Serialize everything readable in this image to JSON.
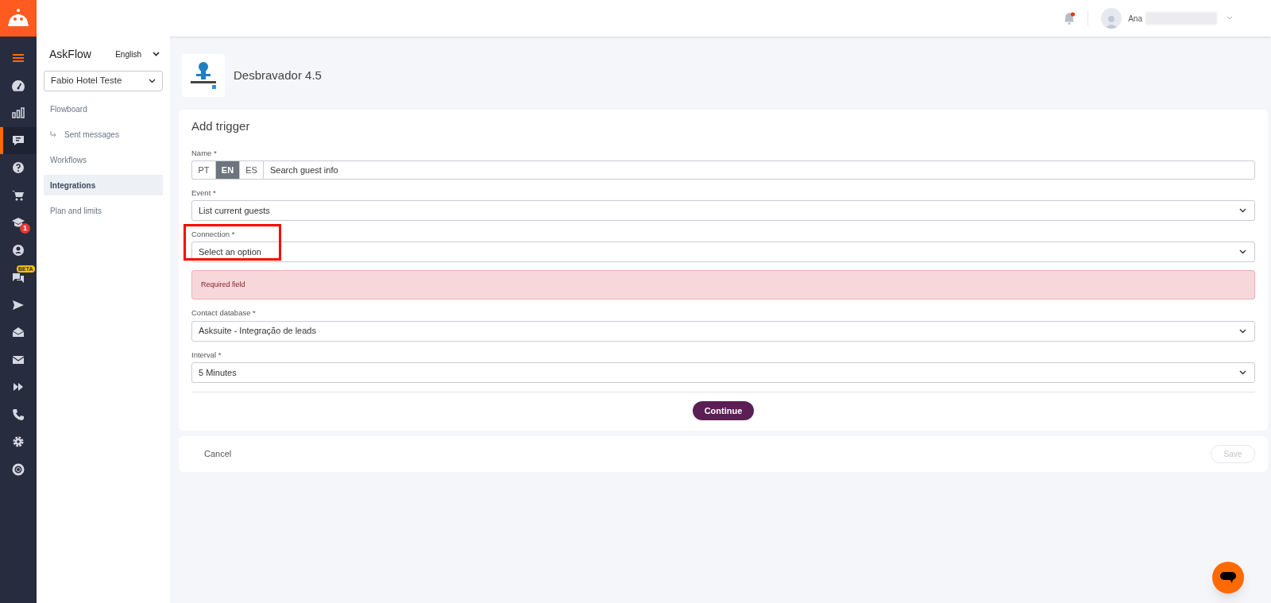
{
  "rail": {
    "items": [
      {
        "kind": "menu",
        "selected": false
      },
      {
        "kind": "gauge",
        "selected": false
      },
      {
        "kind": "chart",
        "selected": false
      },
      {
        "kind": "chat",
        "selected": true
      },
      {
        "kind": "help",
        "selected": false
      },
      {
        "kind": "cart",
        "selected": false
      },
      {
        "kind": "cap",
        "selected": false,
        "badge": "1"
      },
      {
        "kind": "user",
        "selected": false
      },
      {
        "kind": "bubbles",
        "selected": false,
        "tag": "BETA"
      },
      {
        "kind": "send",
        "selected": false
      },
      {
        "kind": "open-mail",
        "selected": false
      },
      {
        "kind": "mail",
        "selected": false
      },
      {
        "kind": "forward",
        "selected": false
      },
      {
        "kind": "phone",
        "selected": false
      },
      {
        "kind": "gear",
        "selected": false
      },
      {
        "kind": "lifebuoy",
        "selected": false
      }
    ]
  },
  "topbar": {
    "notification_dot": true,
    "user_name": "Ana"
  },
  "sidebar": {
    "title": "AskFlow",
    "language": "English",
    "account": "Fabio Hotel Teste",
    "items": [
      {
        "label": "Flowboard",
        "selected": false,
        "children": [
          {
            "label": "Sent messages",
            "selected": false
          }
        ]
      },
      {
        "label": "Workflows",
        "selected": false
      },
      {
        "label": "Integrations",
        "selected": true
      },
      {
        "label": "Plan and limits",
        "selected": false
      }
    ]
  },
  "integration": {
    "title": "Desbravador 4.5"
  },
  "form": {
    "title": "Add trigger",
    "name": {
      "label": "Name *",
      "languages": [
        {
          "label": "PT",
          "selected": false
        },
        {
          "label": "EN",
          "selected": true
        },
        {
          "label": "ES",
          "selected": false
        }
      ],
      "value": "Search guest info"
    },
    "selects": [
      {
        "label": "Event *",
        "value": "List current guests",
        "highlighted": false
      },
      {
        "label": "Connection *",
        "value": "Select an option",
        "highlighted": true,
        "error": "Required field"
      },
      {
        "label": "Contact database *",
        "value": "Asksuite - Integração de leads",
        "highlighted": false
      },
      {
        "label": "Interval *",
        "value": "5 Minutes",
        "highlighted": false
      }
    ],
    "continue": "Continue"
  },
  "footer": {
    "cancel": "Cancel",
    "save": "Save",
    "save_disabled": true
  }
}
